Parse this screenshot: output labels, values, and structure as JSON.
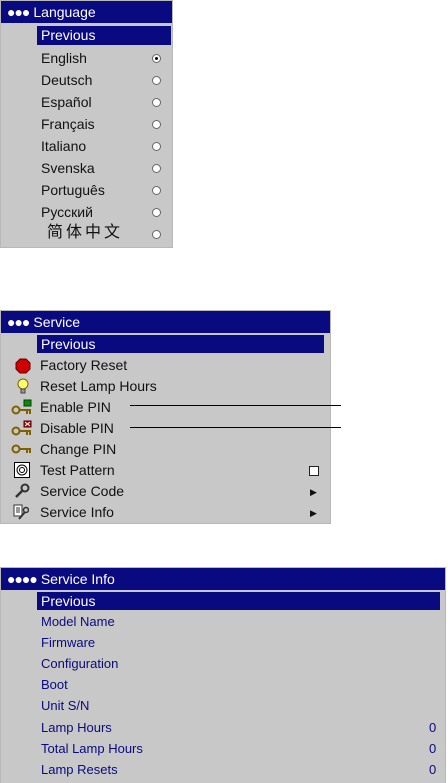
{
  "language": {
    "title": "Language",
    "dots": "●●●",
    "previous": "Previous",
    "items": [
      {
        "label": "English",
        "selected": true
      },
      {
        "label": "Deutsch",
        "selected": false
      },
      {
        "label": "Español",
        "selected": false
      },
      {
        "label": "Français",
        "selected": false
      },
      {
        "label": "Italiano",
        "selected": false
      },
      {
        "label": "Svenska",
        "selected": false
      },
      {
        "label": "Português",
        "selected": false
      },
      {
        "label": "Русский",
        "selected": false
      },
      {
        "label": "简体中文",
        "selected": false
      }
    ]
  },
  "service": {
    "title": "Service",
    "dots": "●●●",
    "previous": "Previous",
    "items": [
      {
        "label": "Factory Reset",
        "icon": "stop-icon"
      },
      {
        "label": "Reset Lamp Hours",
        "icon": "lightbulb-icon"
      },
      {
        "label": "Enable PIN",
        "icon": "key-enable-icon"
      },
      {
        "label": "Disable PIN",
        "icon": "key-disable-icon"
      },
      {
        "label": "Change PIN",
        "icon": "key-icon"
      },
      {
        "label": "Test Pattern",
        "icon": "test-pattern-icon"
      },
      {
        "label": "Service Code",
        "icon": "wrench-icon"
      },
      {
        "label": "Service Info",
        "icon": "service-info-icon"
      }
    ]
  },
  "service_info": {
    "title": "Service Info",
    "dots": "●●●●",
    "previous": "Previous",
    "items": [
      {
        "label": "Model Name",
        "value": ""
      },
      {
        "label": "Firmware",
        "value": ""
      },
      {
        "label": "Configuration",
        "value": ""
      },
      {
        "label": "Boot",
        "value": ""
      },
      {
        "label": "Unit S/N",
        "value": ""
      },
      {
        "label": "Lamp Hours",
        "value": "0"
      },
      {
        "label": "Total Lamp Hours",
        "value": "0"
      },
      {
        "label": "Lamp Resets",
        "value": "0"
      }
    ]
  },
  "colors": {
    "titlebar": "#0a0a80",
    "panel": "#c8c8c8"
  }
}
